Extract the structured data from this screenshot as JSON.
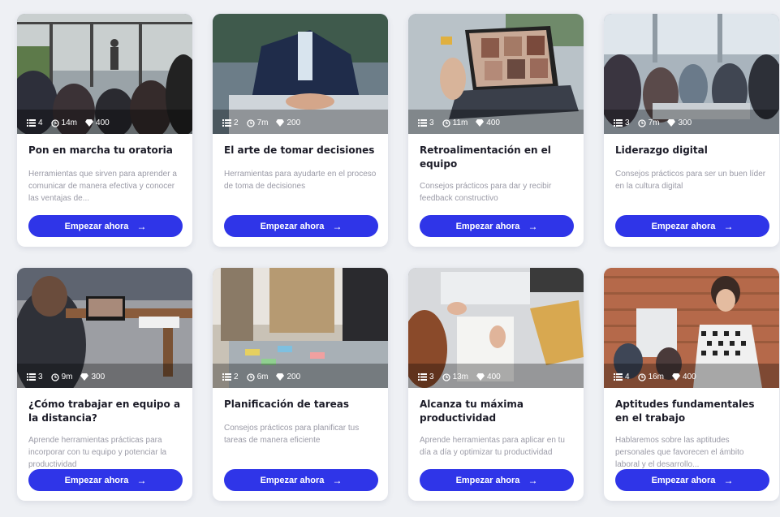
{
  "colors": {
    "accent": "#2f35e8",
    "background": "#eef0f4"
  },
  "cards": [
    {
      "title": "Pon en marcha tu oratoria",
      "description": "Herramientas que sirven para aprender a comunicar de manera efectiva y conocer las ventajas de...",
      "lessons": "4",
      "duration": "14m",
      "points": "400",
      "button_label": "Empezar ahora"
    },
    {
      "title": "El arte de tomar decisiones",
      "description": "Herramientas para ayudarte en el proceso de toma de decisiones",
      "lessons": "2",
      "duration": "7m",
      "points": "200",
      "button_label": "Empezar ahora"
    },
    {
      "title": "Retroalimentación en el equipo",
      "description": "Consejos prácticos para dar y recibir feedback constructivo",
      "lessons": "3",
      "duration": "11m",
      "points": "400",
      "button_label": "Empezar ahora"
    },
    {
      "title": "Liderazgo digital",
      "description": "Consejos prácticos para ser un buen líder en la cultura digital",
      "lessons": "3",
      "duration": "7m",
      "points": "300",
      "button_label": "Empezar ahora"
    },
    {
      "title": "¿Cómo trabajar en equipo a la distancia?",
      "description": "Aprende herramientas prácticas para incorporar con tu equipo y potenciar la productividad",
      "lessons": "3",
      "duration": "9m",
      "points": "300",
      "button_label": "Empezar ahora"
    },
    {
      "title": "Planificación de tareas",
      "description": "Consejos prácticos para planificar tus tareas de manera eficiente",
      "lessons": "2",
      "duration": "6m",
      "points": "200",
      "button_label": "Empezar ahora"
    },
    {
      "title": "Alcanza tu máxima productividad",
      "description": "Aprende herramientas para aplicar en tu día a día y optimizar tu productividad",
      "lessons": "3",
      "duration": "13m",
      "points": "400",
      "button_label": "Empezar ahora"
    },
    {
      "title": "Aptitudes fundamentales en el trabajo",
      "description": "Hablaremos sobre las aptitudes personales que favorecen el ámbito laboral y el desarrollo...",
      "lessons": "4",
      "duration": "16m",
      "points": "400",
      "button_label": "Empezar ahora"
    }
  ]
}
